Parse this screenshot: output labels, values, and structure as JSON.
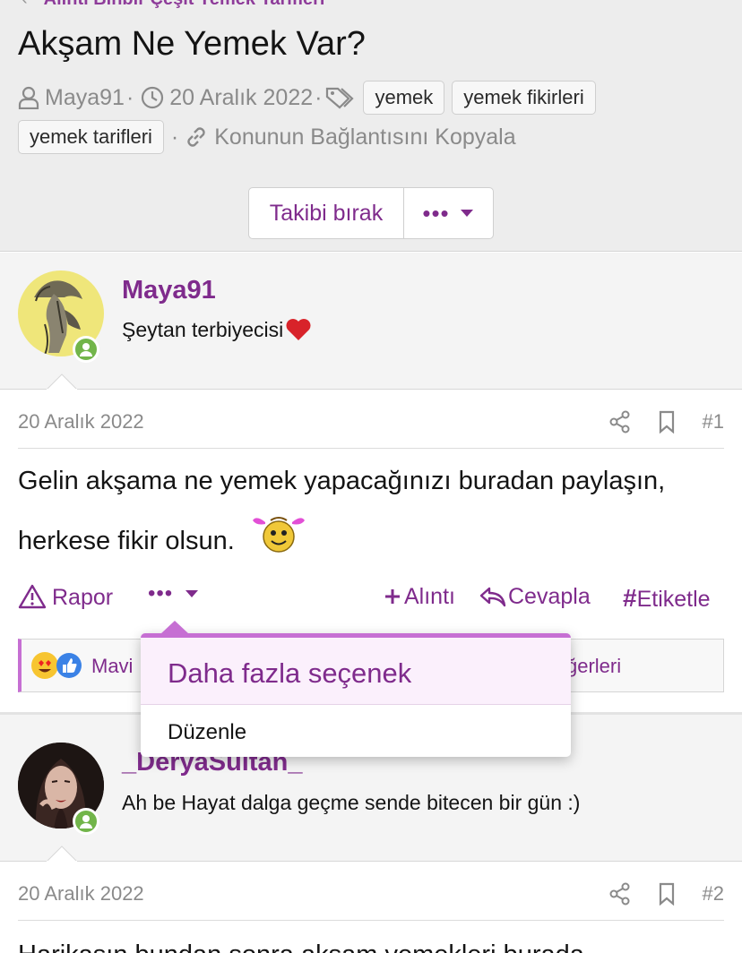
{
  "breadcrumb": {
    "label": "Alıntı Binbir Çeşit Yemek Tarifleri"
  },
  "thread": {
    "title": "Akşam Ne Yemek Var?",
    "author": "Maya91",
    "date": "20 Aralık 2022",
    "tags": [
      "yemek",
      "yemek fikirleri",
      "yemek tarifleri"
    ],
    "copy_link": "Konunun Bağlantısını Kopyala",
    "unfollow_label": "Takibi bırak",
    "more_label": "•••"
  },
  "posts": [
    {
      "author": "Maya91",
      "user_title": "Şeytan terbiyecisi",
      "date": "20 Aralık 2022",
      "number": "#1",
      "body_line1": "Gelin akşama ne yemek yapacağınızı buradan paylaşın,",
      "body_line2": "herkese fikir olsun.",
      "actions": {
        "report": "Rapor",
        "more": "•••",
        "quote": "Alıntı",
        "reply": "Cevapla",
        "tag": "Etiketle"
      },
      "reactions": {
        "left_text": "Mavi",
        "right_text": "ğerleri"
      }
    },
    {
      "author": "_DeryaSultan_",
      "user_title": "Ah be Hayat dalga geçme sende bitecen bir gün :)",
      "date": "20 Aralık 2022",
      "number": "#2",
      "body_partial": "Harikasın bundan sonra akşam yemekleri burada"
    }
  ],
  "dropdown": {
    "header": "Daha fazla seçenek",
    "items": [
      "Düzenle"
    ]
  },
  "colors": {
    "accent": "#7f2b8c",
    "menu_border": "#c66fd3",
    "online": "#72b54a"
  }
}
